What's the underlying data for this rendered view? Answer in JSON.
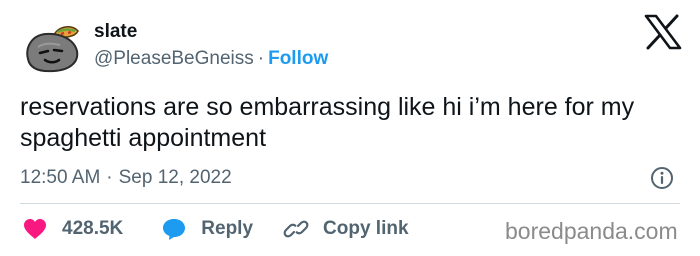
{
  "author": {
    "name": "slate",
    "handle": "@PleaseBeGneiss",
    "separator": "·",
    "follow_label": "Follow",
    "avatar_icon": "rock-with-taco-avatar"
  },
  "platform_icon": "x-logo-icon",
  "tweet": {
    "text": "reservations are so embarrassing like hi i’m here for my spaghetti appointment",
    "time": "12:50 AM",
    "separator": "·",
    "date": "Sep 12, 2022"
  },
  "actions": {
    "like": {
      "count": "428.5K",
      "icon": "heart-icon"
    },
    "reply": {
      "label": "Reply",
      "icon": "speech-bubble-icon"
    },
    "copy_link": {
      "label": "Copy link",
      "icon": "link-icon"
    }
  },
  "watermark": "boredpanda.com",
  "colors": {
    "text_primary": "#0f1419",
    "text_secondary": "#536471",
    "accent_blue": "#1d9bf0",
    "like_red": "#f91880",
    "divider": "#cfd9de"
  }
}
